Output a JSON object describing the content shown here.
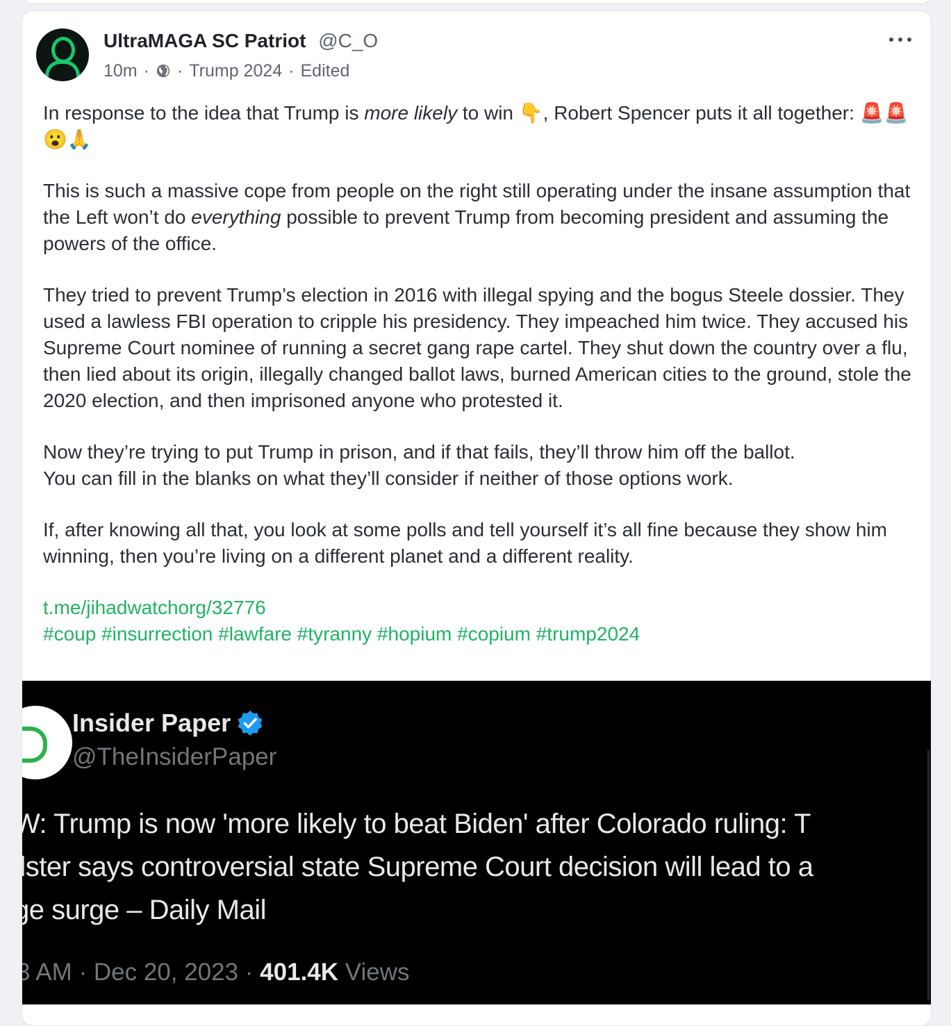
{
  "post": {
    "display_name": "UltraMAGA SC Patriot",
    "handle": "@C_O",
    "time": "10m",
    "separator": "·",
    "visibility_icon": "globe-icon",
    "group": "Trump 2024",
    "edited": "Edited",
    "menu_icon": "more-horizontal-icon",
    "p1_before": "In response to the idea that Trump is ",
    "p1_emph": "more likely",
    "p1_after": " to win 👇, Robert Spencer puts it all together: 🚨🚨😮🙏",
    "p2_before": "This is such a massive cope from people on the right still operating under the insane assumption that the Left won’t do ",
    "p2_emph": "everything",
    "p2_after": " possible to prevent Trump from becoming president and assuming the powers of the office.",
    "p3": "They tried to prevent Trump’s election in 2016 with illegal spying and the bogus Steele dossier. They used a lawless FBI operation to cripple his presidency. They impeached him twice. They accused his Supreme Court nominee of running a secret gang rape cartel. They shut down the country over a flu, then lied about its origin, illegally changed ballot laws, burned American cities to the ground, stole the 2020 election, and then imprisoned anyone who protested it.",
    "p4_line1": "Now they’re trying to put Trump in prison, and if that fails, they’ll throw him off the ballot.",
    "p4_line2": "You can fill in the blanks on what they’ll consider if neither of those options work.",
    "p5": "If, after knowing all that, you look at some polls and tell yourself it’s all fine because they show him winning, then you’re living on a different planet and a different reality.",
    "link": "t.me/jihadwatchorg/32776",
    "hashtags": "#coup #insurrection #lawfare #tyranny #hopium #copium #trump2024"
  },
  "embed": {
    "name": "Insider Paper",
    "handle": "@TheInsiderPaper",
    "line1": "W: Trump is now 'more likely to beat Biden' after Colorado ruling: T",
    "line2": "llster says controversial state Supreme Court decision will lead to a",
    "line3": "ge surge – Daily Mail",
    "footer_time": "3 AM · Dec 20, 2023 · ",
    "views_count": "401.4K",
    "views_label": " Views"
  },
  "colors": {
    "accent": "#1fb463",
    "avatar_green": "#18c76c",
    "verified_blue": "#1d9bf0"
  }
}
